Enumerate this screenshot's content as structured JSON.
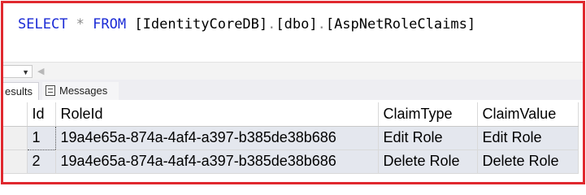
{
  "query": {
    "keyword_select": "SELECT",
    "star": "*",
    "keyword_from": "FROM",
    "database": "[IdentityCoreDB]",
    "dot1": ".",
    "schema": "[dbo]",
    "dot2": ".",
    "table": "[AspNetRoleClaims]"
  },
  "colors": {
    "keyword": "#1b2bd6",
    "operator": "#8a8a8a",
    "frame_border": "#e0282e",
    "selected_row": "#e4e7ee"
  },
  "tabs": {
    "results_label": "esults",
    "messages_label": "Messages"
  },
  "table": {
    "headers": [
      "Id",
      "RoleId",
      "ClaimType",
      "ClaimValue"
    ],
    "rows": [
      {
        "num": "1",
        "roleid": "19a4e65a-874a-4af4-a397-b385de38b686",
        "claimtype": "Edit Role",
        "claimvalue": "Edit Role"
      },
      {
        "num": "2",
        "roleid": "19a4e65a-874a-4af4-a397-b385de38b686",
        "claimtype": "Delete Role",
        "claimvalue": "Delete Role"
      }
    ]
  },
  "icons": [
    "chevron-down-icon",
    "scroll-left-arrow-icon",
    "messages-icon"
  ]
}
